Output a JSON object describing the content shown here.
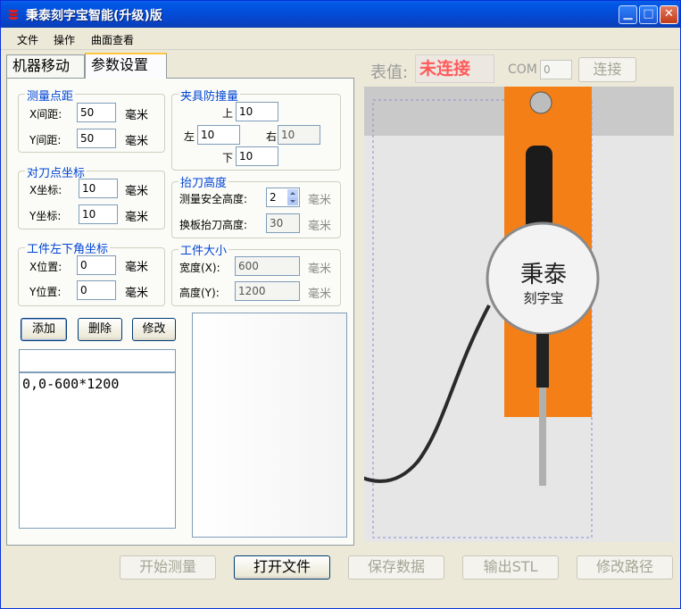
{
  "window": {
    "title": "秉泰刻字宝智能(升级)版",
    "min": "▁",
    "max": "□",
    "close": "✕"
  },
  "menu": [
    "文件",
    "操作",
    "曲面查看"
  ],
  "tabs": [
    "机器移动",
    "参数设置"
  ],
  "measure_spacing": {
    "title": "测量点距",
    "x_label": "X间距:",
    "x_value": "50",
    "y_label": "Y间距:",
    "y_value": "50",
    "unit": "毫米"
  },
  "tool_coord": {
    "title": "对刀点坐标",
    "x_label": "X坐标:",
    "x_value": "10",
    "y_label": "Y坐标:",
    "y_value": "10",
    "unit": "毫米"
  },
  "workpiece_corner": {
    "title": "工件左下角坐标",
    "x_label": "X位置:",
    "x_value": "0",
    "y_label": "Y位置:",
    "y_value": "0",
    "unit": "毫米"
  },
  "clamp": {
    "title": "夹具防撞量",
    "top_label": "上",
    "top_value": "10",
    "left_label": "左",
    "left_value": "10",
    "right_label": "右",
    "right_value": "10",
    "bottom_label": "下",
    "bottom_value": "10"
  },
  "lift": {
    "title": "抬刀高度",
    "safe_label": "测量安全高度:",
    "safe_value": "2",
    "change_label": "换板抬刀高度:",
    "change_value": "30",
    "unit": "毫米"
  },
  "size": {
    "title": "工件大小",
    "w_label": "宽度(X):",
    "w_value": "600",
    "h_label": "高度(Y):",
    "h_value": "1200",
    "unit": "毫米"
  },
  "buttons": {
    "add": "添加",
    "delete": "删除",
    "modify": "修改"
  },
  "list": {
    "input": "",
    "items": [
      "0,0-600*1200"
    ]
  },
  "gauge": {
    "label": "表值:",
    "status": "未连接",
    "status_color": "#ff5a5a",
    "com_label": "COM",
    "com_value": "0",
    "connect": "连接"
  },
  "bottom": {
    "start": "开始测量",
    "open": "打开文件",
    "save": "保存数据",
    "export": "输出STL",
    "path": "修改路径"
  },
  "logo": {
    "line1": "秉泰",
    "line2": "刻字宝"
  }
}
